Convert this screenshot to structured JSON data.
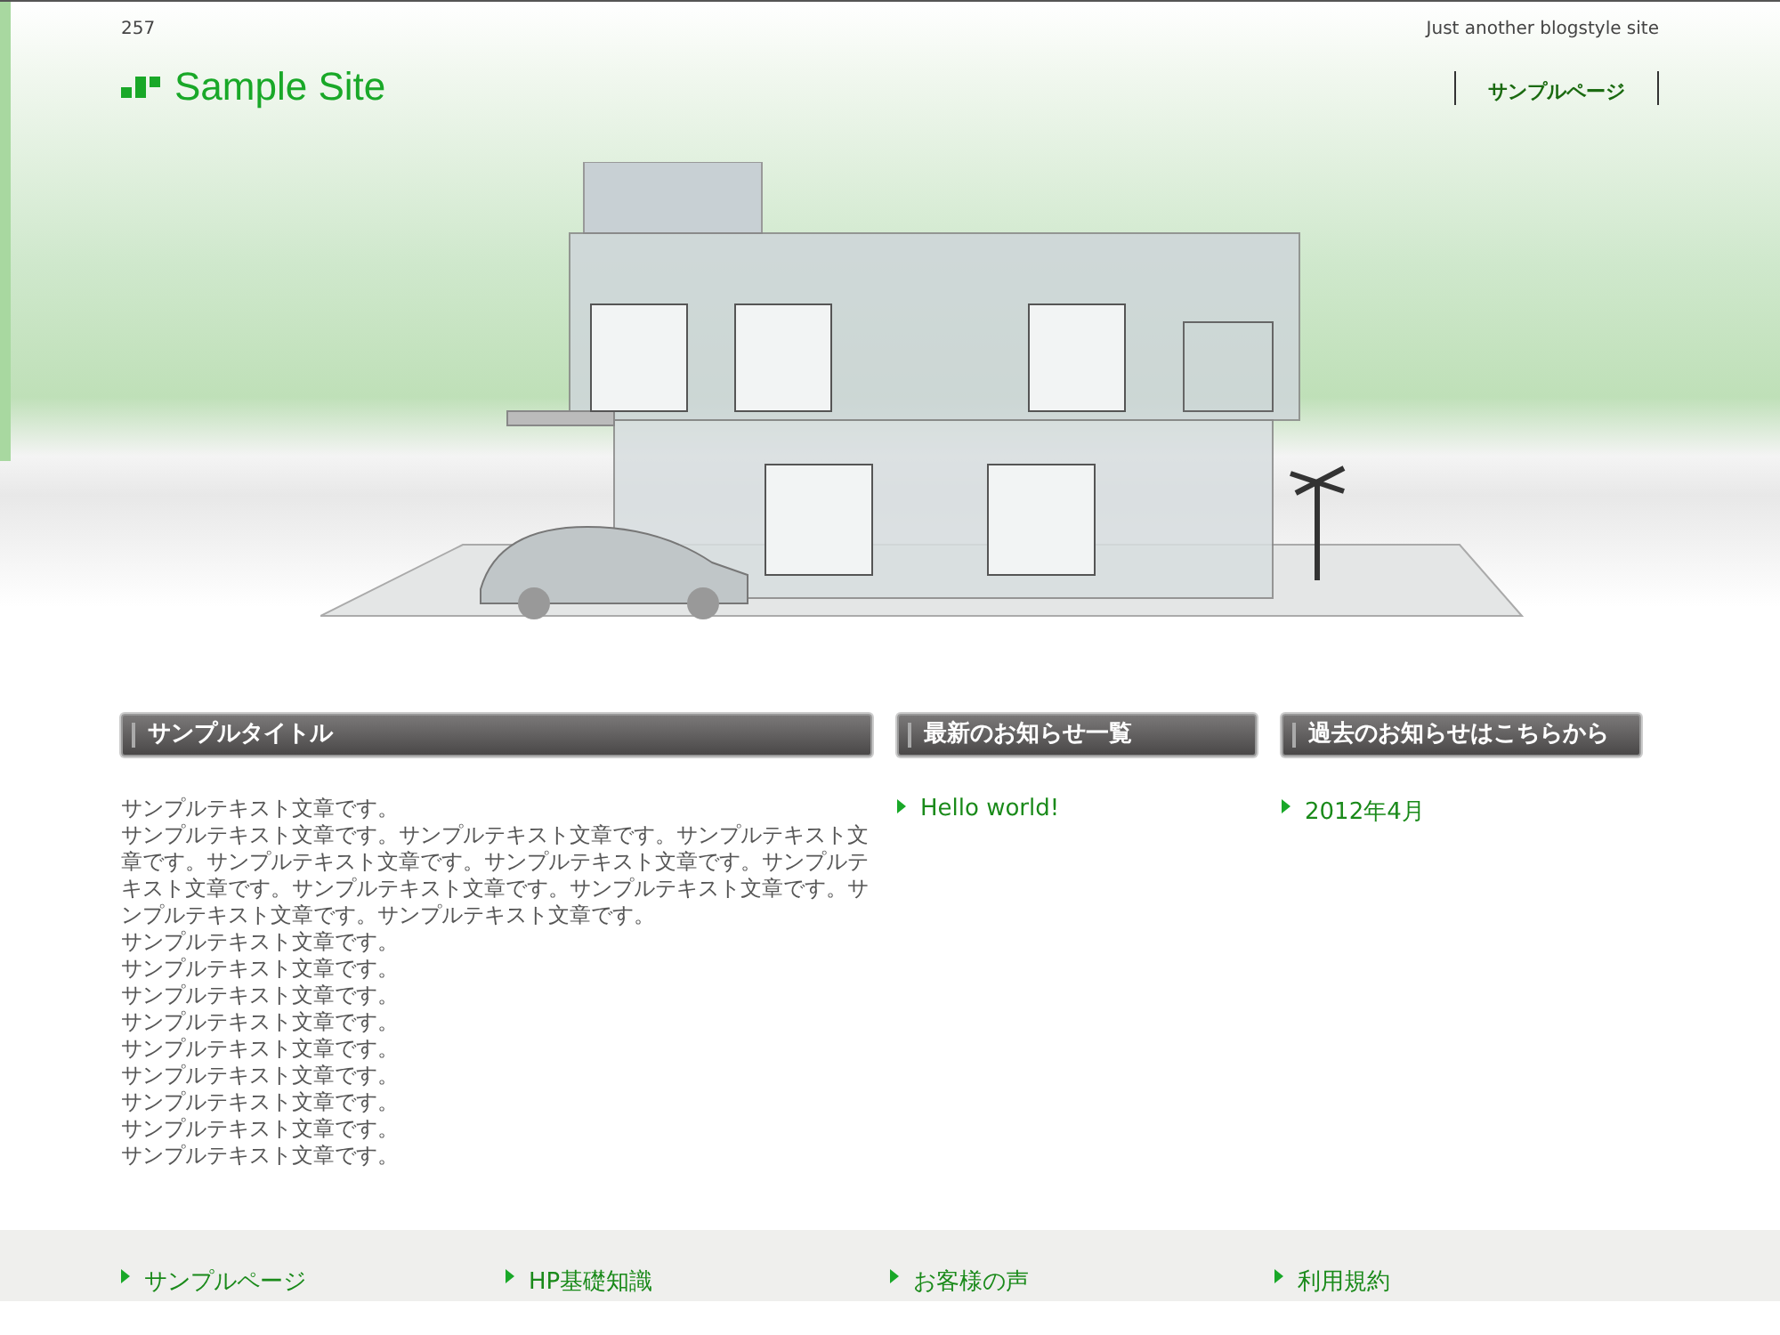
{
  "header": {
    "counter": "257",
    "tagline": "Just another blogstyle site",
    "site_name": "Sample Site",
    "nav": [
      {
        "label": "サンプルページ"
      }
    ]
  },
  "main": {
    "title": "サンプルタイトル",
    "paragraphs": [
      "サンプルテキスト文章です。",
      "サンプルテキスト文章です。サンプルテキスト文章です。サンプルテキスト文章です。サンプルテキスト文章です。サンプルテキスト文章です。サンプルテキスト文章です。サンプルテキスト文章です。サンプルテキスト文章です。サンプルテキスト文章です。サンプルテキスト文章です。",
      "サンプルテキスト文章です。",
      "サンプルテキスト文章です。",
      "サンプルテキスト文章です。",
      "サンプルテキスト文章です。",
      "サンプルテキスト文章です。",
      "サンプルテキスト文章です。",
      "サンプルテキスト文章です。",
      "サンプルテキスト文章です。",
      "サンプルテキスト文章です。"
    ]
  },
  "widgets": [
    {
      "title": "最新のお知らせ一覧",
      "links": [
        "Hello world!"
      ]
    },
    {
      "title": "過去のお知らせはこちらから",
      "links": [
        "2012年4月"
      ]
    }
  ],
  "footer": {
    "links": [
      "サンプルページ",
      "HP基礎知識",
      "お客様の声",
      "利用規約"
    ]
  }
}
